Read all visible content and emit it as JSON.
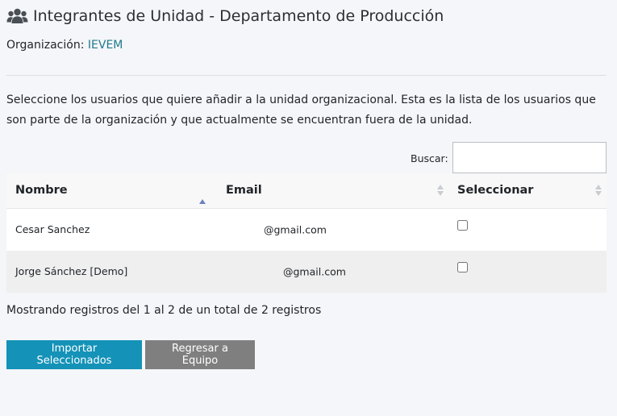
{
  "header": {
    "title": "Integrantes de Unidad - Departamento de Producción",
    "icon": "users-icon"
  },
  "organization": {
    "label": "Organización:",
    "value": "IEVEM",
    "link_color": "#1f7a8c"
  },
  "description": "Seleccione los usuarios que quiere añadir a la unidad organizacional. Esta es la lista de los usuarios que son parte de la organización y que actualmente se encuentran fuera de la unidad.",
  "search": {
    "label": "Buscar:",
    "value": "",
    "placeholder": ""
  },
  "table": {
    "columns": [
      "Nombre",
      "Email",
      "Seleccionar"
    ],
    "sorted_column": "Nombre",
    "sort_direction": "asc",
    "rows": [
      {
        "name": "Cesar Sanchez",
        "email": "@gmail.com",
        "selected": false
      },
      {
        "name": "Jorge Sánchez [Demo]",
        "email": "@gmail.com",
        "selected": false
      }
    ]
  },
  "info_text": "Mostrando registros del 1 al 2 de un total de 2 registros",
  "buttons": {
    "import_label": "Importar Seleccionados",
    "back_label": "Regresar a Equipo",
    "primary_color": "#1492b8",
    "secondary_color": "#7f7f7f"
  }
}
